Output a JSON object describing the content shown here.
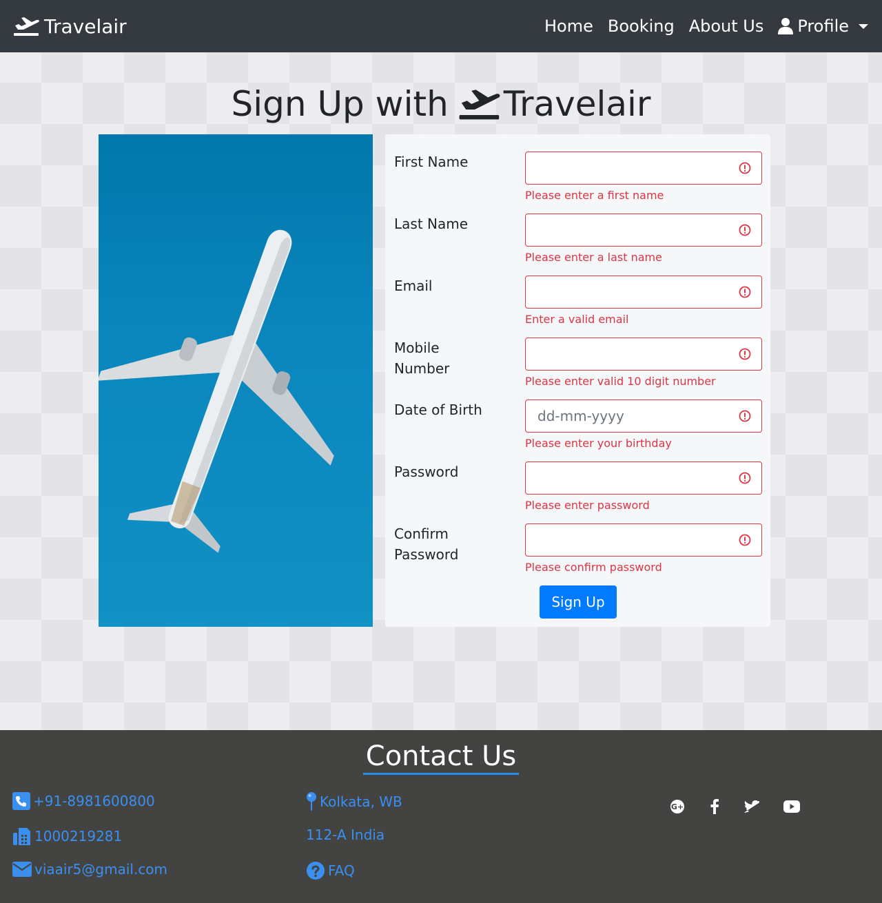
{
  "navbar": {
    "brand": "Travelair",
    "links": [
      "Home",
      "Booking",
      "About Us"
    ],
    "profile_label": "Profile"
  },
  "title": {
    "prefix": "Sign Up with",
    "brand": "Travelair"
  },
  "form": {
    "fields": [
      {
        "label": "First Name",
        "placeholder": "",
        "error": "Please enter a first name"
      },
      {
        "label": "Last Name",
        "placeholder": "",
        "error": "Please enter a last name"
      },
      {
        "label": "Email",
        "placeholder": "",
        "error": "Enter a valid email"
      },
      {
        "label": "Mobile Number",
        "placeholder": "",
        "error": "Please enter valid 10 digit number"
      },
      {
        "label": "Date of Birth",
        "placeholder": "dd-mm-yyyy",
        "error": "Please enter your birthday"
      },
      {
        "label": "Password",
        "placeholder": "",
        "error": "Please enter password"
      },
      {
        "label": "Confirm Password",
        "placeholder": "",
        "error": "Please confirm password"
      }
    ],
    "submit_label": "Sign Up"
  },
  "footer": {
    "title": "Contact Us",
    "phone": "+91-8981600800",
    "fax": "1000219281",
    "email": "viaair5@gmail.com",
    "location": "Kolkata, WB",
    "address": "112-A India",
    "faq": "FAQ",
    "socials": [
      "google-plus-icon",
      "facebook-icon",
      "twitter-icon",
      "youtube-icon"
    ]
  },
  "colors": {
    "navbar": "#343a40",
    "footer": "#434442",
    "accent": "#007bff",
    "error": "#dc3545",
    "link": "#3b8ff0"
  }
}
